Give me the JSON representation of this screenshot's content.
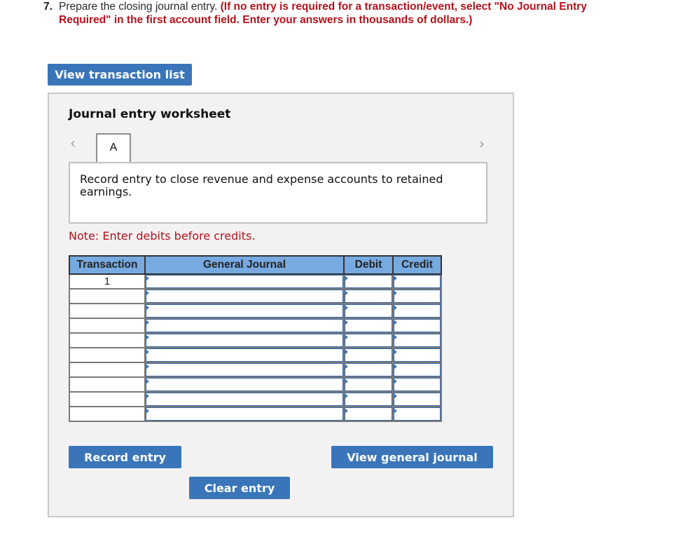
{
  "question": {
    "number": "7.",
    "text": "Prepare the closing journal entry.",
    "instruction_line1": "(If no entry is required for a transaction/event, select \"No Journal Entry",
    "instruction_line2": "Required\" in the first account field. Enter your answers in thousands of dollars.)"
  },
  "buttons": {
    "view_transaction_list": "View transaction list",
    "record_entry": "Record entry",
    "clear_entry": "Clear entry",
    "view_general_journal": "View general journal"
  },
  "worksheet": {
    "title": "Journal entry worksheet",
    "prev_icon": "‹",
    "next_icon": "›",
    "tabs": [
      {
        "label": "A",
        "active": true
      }
    ],
    "description": "Record entry to close revenue and expense accounts to retained earnings.",
    "note": "Note: Enter debits before credits."
  },
  "journal_table": {
    "headers": [
      "Transaction",
      "General Journal",
      "Debit",
      "Credit"
    ],
    "rows": [
      {
        "transaction": "1",
        "account": "",
        "debit": "",
        "credit": ""
      },
      {
        "transaction": "",
        "account": "",
        "debit": "",
        "credit": ""
      },
      {
        "transaction": "",
        "account": "",
        "debit": "",
        "credit": ""
      },
      {
        "transaction": "",
        "account": "",
        "debit": "",
        "credit": ""
      },
      {
        "transaction": "",
        "account": "",
        "debit": "",
        "credit": ""
      },
      {
        "transaction": "",
        "account": "",
        "debit": "",
        "credit": ""
      },
      {
        "transaction": "",
        "account": "",
        "debit": "",
        "credit": ""
      },
      {
        "transaction": "",
        "account": "",
        "debit": "",
        "credit": ""
      },
      {
        "transaction": "",
        "account": "",
        "debit": "",
        "credit": ""
      },
      {
        "transaction": "",
        "account": "",
        "debit": "",
        "credit": ""
      }
    ]
  },
  "colors": {
    "accent_button": "#3a75b9",
    "instruction_red": "#b5121b",
    "table_header": "#76aae0",
    "panel_bg": "#f2f2f2"
  }
}
